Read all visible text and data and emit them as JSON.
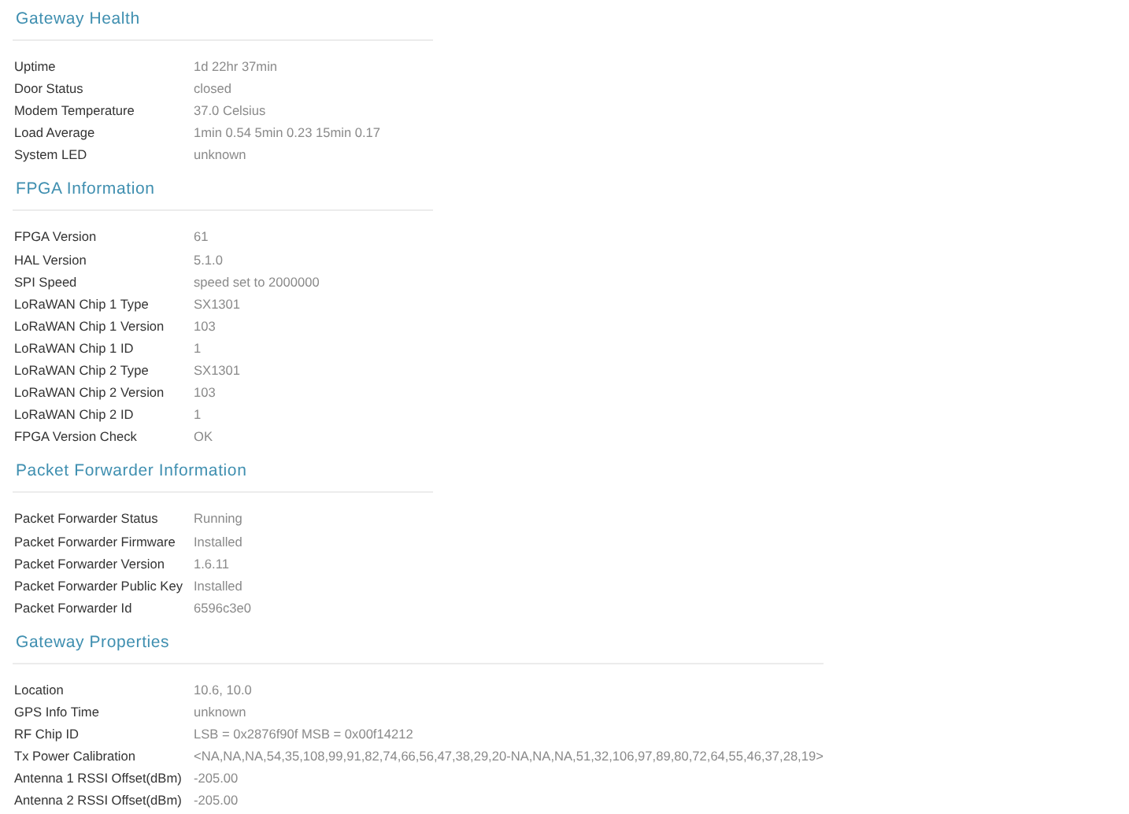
{
  "sections": [
    {
      "title": "Gateway Health",
      "rows": [
        {
          "label": "Uptime",
          "value": "1d 22hr 37min"
        },
        {
          "label": "Door Status",
          "value": "closed"
        },
        {
          "label": "Modem Temperature",
          "value": "37.0 Celsius"
        },
        {
          "label": "Load Average",
          "value": "1min 0.54 5min 0.23 15min 0.17"
        },
        {
          "label": "System LED",
          "value": "unknown"
        }
      ]
    },
    {
      "title": "FPGA Information",
      "rows": [
        {
          "label": "FPGA Version",
          "value": "61"
        },
        {
          "label": "HAL Version",
          "value": "5.1.0"
        },
        {
          "label": "SPI Speed",
          "value": "speed set to 2000000"
        },
        {
          "label": "LoRaWAN Chip 1 Type",
          "value": "SX1301"
        },
        {
          "label": "LoRaWAN Chip 1 Version",
          "value": "103"
        },
        {
          "label": "LoRaWAN Chip 1 ID",
          "value": "1"
        },
        {
          "label": "LoRaWAN Chip 2 Type",
          "value": "SX1301"
        },
        {
          "label": "LoRaWAN Chip 2 Version",
          "value": "103"
        },
        {
          "label": "LoRaWAN Chip 2 ID",
          "value": "1"
        },
        {
          "label": "FPGA Version Check",
          "value": "OK"
        }
      ]
    },
    {
      "title": "Packet Forwarder Information",
      "rows": [
        {
          "label": "Packet Forwarder Status",
          "value": "Running"
        },
        {
          "label": "Packet Forwarder Firmware",
          "value": "Installed"
        },
        {
          "label": "Packet Forwarder Version",
          "value": "1.6.11"
        },
        {
          "label": "Packet Forwarder Public Key",
          "value": "Installed"
        },
        {
          "label": "Packet Forwarder Id",
          "value": "6596c3e0"
        }
      ]
    },
    {
      "title": "Gateway Properties",
      "rows": [
        {
          "label": "Location",
          "value": "10.6, 10.0"
        },
        {
          "label": "GPS Info Time",
          "value": "unknown"
        },
        {
          "label": "RF Chip ID",
          "value": "LSB = 0x2876f90f MSB = 0x00f14212"
        },
        {
          "label": "Tx Power Calibration",
          "value": "<NA,NA,NA,54,35,108,99,91,82,74,66,56,47,38,29,20-NA,NA,NA,51,32,106,97,89,80,72,64,55,46,37,28,19>"
        },
        {
          "label": "Antenna 1 RSSI Offset(dBm)",
          "value": "-205.00"
        },
        {
          "label": "Antenna 2 RSSI Offset(dBm)",
          "value": "-205.00"
        }
      ]
    }
  ]
}
